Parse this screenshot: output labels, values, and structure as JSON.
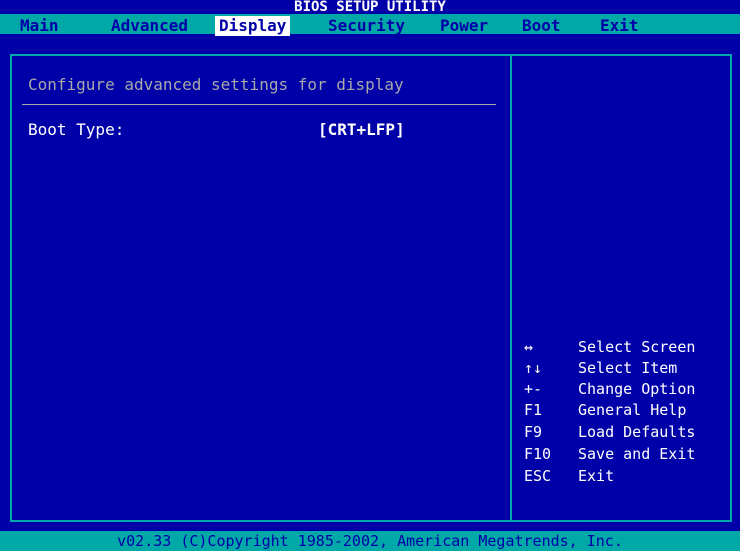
{
  "title": "BIOS SETUP UTILITY",
  "tabs": [
    {
      "label": "Main"
    },
    {
      "label": "Advanced"
    },
    {
      "label": "Display"
    },
    {
      "label": "Security"
    },
    {
      "label": "Power"
    },
    {
      "label": "Boot"
    },
    {
      "label": "Exit"
    }
  ],
  "active_tab": "Display",
  "description": "Configure advanced settings for display",
  "option": {
    "label": "Boot Type:",
    "value": "[CRT+LFP]"
  },
  "help": [
    {
      "key": "↔",
      "desc": "Select Screen"
    },
    {
      "key": "↑↓",
      "desc": "Select Item"
    },
    {
      "key": "+-",
      "desc": "Change Option"
    },
    {
      "key": "F1",
      "desc": "General Help"
    },
    {
      "key": "F9",
      "desc": "Load Defaults"
    },
    {
      "key": "F10",
      "desc": "Save and Exit"
    },
    {
      "key": "ESC",
      "desc": "Exit"
    }
  ],
  "footer": "v02.33 (C)Copyright 1985-2002, American Megatrends, Inc.",
  "colors": {
    "background": "#0000a8",
    "menu": "#00a8a8",
    "text": "#ffffff",
    "muted": "#a8a8a8"
  }
}
